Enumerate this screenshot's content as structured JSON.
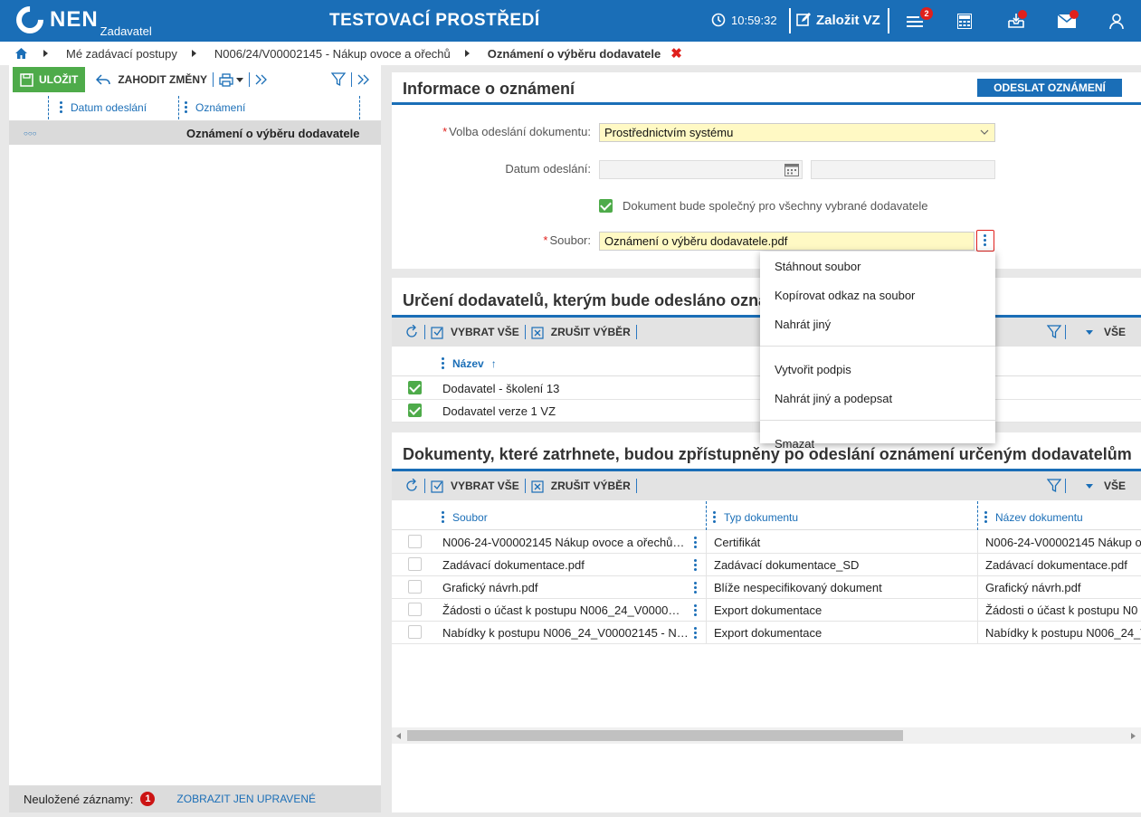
{
  "header": {
    "logo_text": "NEN",
    "logo_sub": "Zadavatel",
    "env_title": "TESTOVACÍ PROSTŘEDÍ",
    "time": "10:59:32",
    "create_label": "Založit VZ",
    "menu_badge": "2",
    "accent_color": "#1a6eb7",
    "icons": [
      "clock-icon",
      "edit-icon",
      "menu-icon",
      "calculator-icon",
      "inbox-icon",
      "mail-icon",
      "user-icon"
    ]
  },
  "breadcrumb": {
    "items": [
      "Mé zadávací postupy",
      "N006/24/V00002145 - Nákup ovoce a ořechů"
    ],
    "current": "Oznámení o výběru dodavatele",
    "close": "✖"
  },
  "left": {
    "save_label": "ULOŽIT",
    "discard_label": "ZAHODIT ZMĚNY",
    "columns": [
      "Datum odeslání",
      "Oznámení"
    ],
    "row_marker": "○○○",
    "row_value": "Oznámení o výběru dodavatele",
    "footer_label": "Neuložené záznamy:",
    "footer_count": "1",
    "footer_link": "ZOBRAZIT JEN UPRAVENÉ"
  },
  "info": {
    "title": "Informace o oznámení",
    "send_button": "ODESLAT OZNÁMENÍ",
    "send_label": "Volba odeslání dokumentu:",
    "send_value": "Prostřednictvím systému",
    "date_label": "Datum odeslání:",
    "common_label": "Dokument bude společný pro všechny vybrané dodavatele",
    "file_label": "Soubor:",
    "file_value": "Oznámení o výběru dodavatele.pdf"
  },
  "context_menu": {
    "items_group1": [
      "Stáhnout soubor",
      "Kopírovat odkaz na soubor",
      "Nahrát jiný"
    ],
    "items_group2": [
      "Vytvořit podpis",
      "Nahrát jiný a podepsat"
    ],
    "items_group3": [
      "Smazat"
    ]
  },
  "suppliers": {
    "title": "Určení dodavatelů, kterým bude odesláno oznámení",
    "select_all": "VYBRAT VŠE",
    "deselect": "ZRUŠIT VÝBĚR",
    "filter_all": "VŠE",
    "column": "Název",
    "sort_arrow": "↑",
    "rows": [
      "Dodavatel - školení 13",
      "Dodavatel verze 1 VZ"
    ]
  },
  "documents": {
    "title": "Dokumenty, které zatrhnete, budou zpřístupněny po odeslání oznámení určeným dodavatelům",
    "select_all": "VYBRAT VŠE",
    "deselect": "ZRUŠIT VÝBĚR",
    "filter_all": "VŠE",
    "columns": [
      "Soubor",
      "Typ dokumentu",
      "Název dokumentu"
    ],
    "rows": [
      [
        "N006-24-V00002145 Nákup ovoce a ořechů…",
        "Certifikát",
        "N006-24-V00002145 Nákup o"
      ],
      [
        "Zadávací dokumentace.pdf",
        "Zadávací dokumentace_SD",
        "Zadávací dokumentace.pdf"
      ],
      [
        "Grafický návrh.pdf",
        "Blíže nespecifikovaný dokument",
        "Grafický návrh.pdf"
      ],
      [
        "Žádosti o účast k postupu N006_24_V0000…",
        "Export dokumentace",
        "Žádosti o účast k postupu N0"
      ],
      [
        "Nabídky k postupu N006_24_V00002145 - N…",
        "Export dokumentace",
        "Nabídky k postupu N006_24_V"
      ]
    ]
  }
}
